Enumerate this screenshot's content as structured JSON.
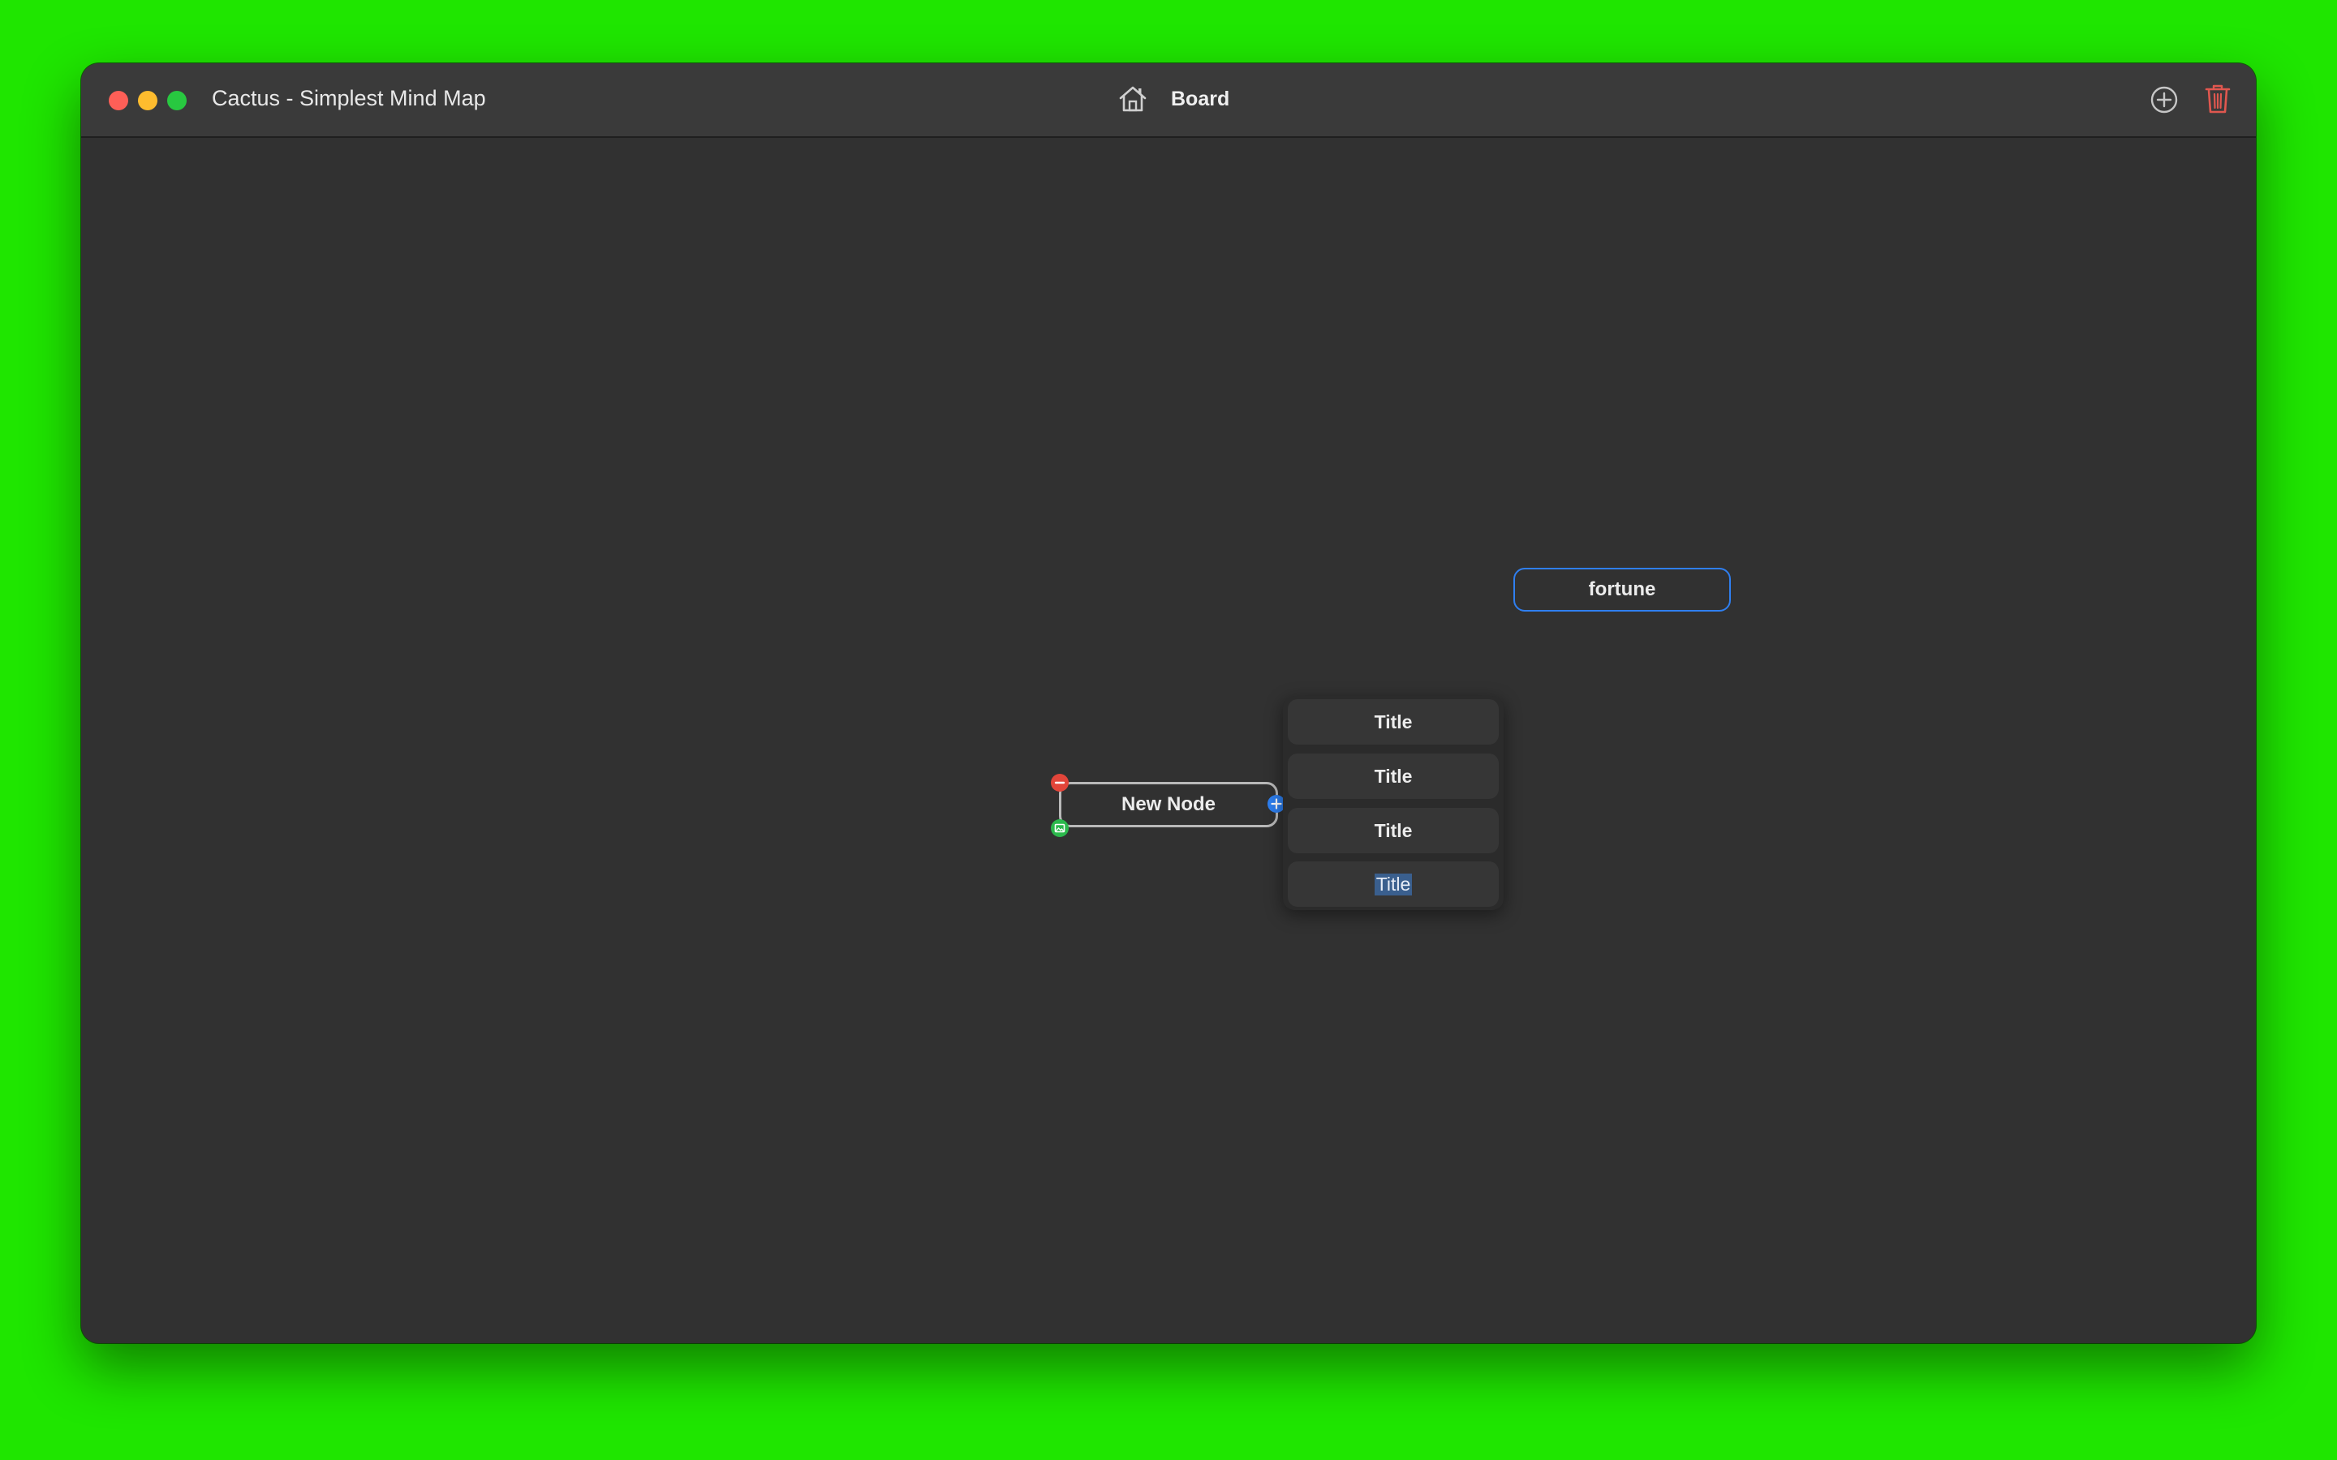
{
  "window": {
    "title": "Cactus - Simplest Mind Map",
    "board_title": "Board"
  },
  "toolbar": {
    "home_icon": "house-icon",
    "add_icon": "plus-circle-icon",
    "delete_icon": "trash-icon"
  },
  "nodes": [
    {
      "label": "fortune",
      "selected": true
    },
    {
      "label": "New Node",
      "editing": true
    }
  ],
  "node_controls": {
    "remove_icon": "minus-circle-icon",
    "image_icon": "image-icon",
    "add_child_icon": "plus-circle-icon"
  },
  "suggestions": [
    {
      "label": "Title"
    },
    {
      "label": "Title"
    },
    {
      "label": "Title"
    },
    {
      "label": "Title",
      "editing": true
    }
  ],
  "colors": {
    "background": "#1fe600",
    "window": "#313131",
    "titlebar": "#3a3a3a",
    "accent_blue": "#2f7ff0",
    "remove_red": "#e2453a",
    "image_green": "#2bb84c",
    "trash_red": "#e0574f"
  }
}
